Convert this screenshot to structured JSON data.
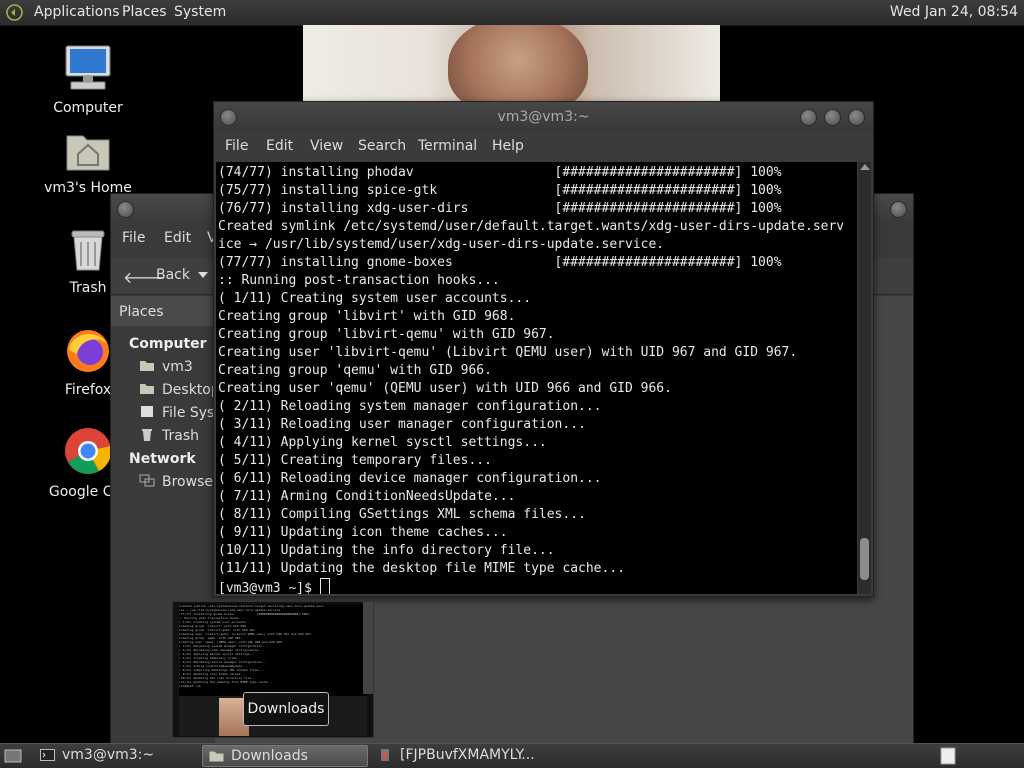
{
  "top_panel": {
    "menus": [
      "Applications",
      "Places",
      "System"
    ],
    "clock": "Wed Jan 24, 08:54"
  },
  "desktop_icons": [
    {
      "label": "Computer",
      "icon": "computer-icon"
    },
    {
      "label": "vm3's Home",
      "icon": "home-folder-icon"
    },
    {
      "label": "Trash",
      "icon": "trash-icon"
    },
    {
      "label": "Firefox",
      "icon": "firefox-icon"
    },
    {
      "label": "Google Chr",
      "icon": "chrome-icon"
    }
  ],
  "file_manager": {
    "menu": [
      "File",
      "Edit",
      "V"
    ],
    "back_label": "Back",
    "places_header": "Places",
    "sections": {
      "computer": "Computer",
      "network": "Network"
    },
    "computer_items": [
      "vm3",
      "Desktop",
      "File Syste",
      "Trash"
    ],
    "network_items": [
      "Browse N"
    ]
  },
  "terminal": {
    "title": "vm3@vm3:~",
    "menu": [
      "File",
      "Edit",
      "View",
      "Search",
      "Terminal",
      "Help"
    ],
    "lines": [
      "(74/77) installing phodav                  [######################] 100%",
      "(75/77) installing spice-gtk               [######################] 100%",
      "(76/77) installing xdg-user-dirs           [######################] 100%",
      "Created symlink /etc/systemd/user/default.target.wants/xdg-user-dirs-update.serv",
      "ice → /usr/lib/systemd/user/xdg-user-dirs-update.service.",
      "(77/77) installing gnome-boxes             [######################] 100%",
      ":: Running post-transaction hooks...",
      "( 1/11) Creating system user accounts...",
      "Creating group 'libvirt' with GID 968.",
      "Creating group 'libvirt-qemu' with GID 967.",
      "Creating user 'libvirt-qemu' (Libvirt QEMU user) with UID 967 and GID 967.",
      "Creating group 'qemu' with GID 966.",
      "Creating user 'qemu' (QEMU user) with UID 966 and GID 966.",
      "( 2/11) Reloading system manager configuration...",
      "( 3/11) Reloading user manager configuration...",
      "( 4/11) Applying kernel sysctl settings...",
      "( 5/11) Creating temporary files...",
      "( 6/11) Reloading device manager configuration...",
      "( 7/11) Arming ConditionNeedsUpdate...",
      "( 8/11) Compiling GSettings XML schema files...",
      "( 9/11) Updating icon theme caches...",
      "(10/11) Updating the info directory file...",
      "(11/11) Updating the desktop file MIME type cache..."
    ],
    "prompt": "[vm3@vm3 ~]$ "
  },
  "tooltip": "Downloads",
  "taskbar": [
    {
      "label": "vm3@vm3:~",
      "icon": "terminal-icon",
      "active": false
    },
    {
      "label": "Downloads",
      "icon": "folder-icon",
      "active": true
    },
    {
      "label": "[FJPBuvfXMAMYLY...",
      "icon": "image-viewer-icon",
      "active": false
    }
  ]
}
